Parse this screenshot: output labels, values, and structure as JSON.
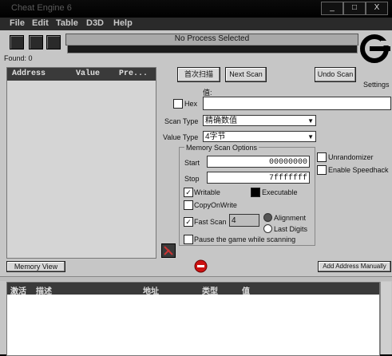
{
  "window": {
    "title": "Cheat Engine 6",
    "controls": [
      "_",
      "□",
      "X"
    ]
  },
  "menu": [
    "File",
    "Edit",
    "Table",
    "D3D",
    "Help"
  ],
  "process_label": "No Process Selected",
  "found_label": "Found: 0",
  "settings_label": "Settings",
  "results": {
    "headers": [
      "Address",
      "Value",
      "Pre..."
    ]
  },
  "buttons": {
    "first_scan": "首次扫描",
    "next_scan": "Next Scan",
    "undo_scan": "Undo Scan",
    "memory_view": "Memory View",
    "add_address": "Add Address Manually"
  },
  "scan": {
    "value_label": "值:",
    "hex_label": "Hex",
    "scan_type_label": "Scan Type",
    "scan_type_value": "精确数值",
    "value_type_label": "Value Type",
    "value_type_value": "4字节"
  },
  "memory_options": {
    "title": "Memory Scan Options",
    "start_label": "Start",
    "start_value": "00000000",
    "stop_label": "Stop",
    "stop_value": "7fffffff",
    "writable": "Writable",
    "executable": "Executable",
    "copy_on_write": "CopyOnWrite",
    "fast_scan": "Fast Scan",
    "fast_scan_value": "4",
    "alignment": "Alignment",
    "last_digits": "Last Digits",
    "pause": "Pause the game while scanning"
  },
  "right_options": {
    "unrandomizer": "Unrandomizer",
    "speedhack": "Enable Speedhack"
  },
  "address_table": {
    "headers": [
      "激活",
      "描述",
      "地址",
      "类型",
      "值"
    ]
  },
  "colors": {
    "client_bg": "#c6c6c6",
    "dark": "#2a2a2a",
    "stop_icon": "#cc1111"
  }
}
